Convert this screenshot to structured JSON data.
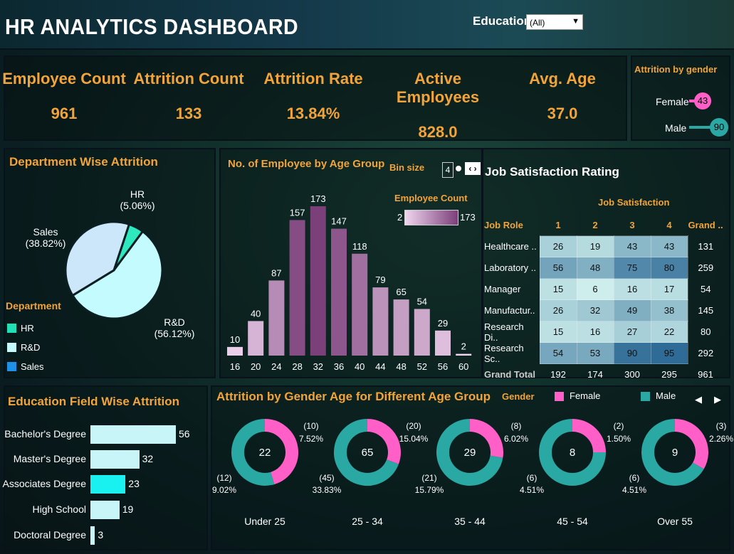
{
  "header": {
    "title": "HR ANALYTICS DASHBOARD",
    "education_label": "Education",
    "education_value": "(All)"
  },
  "kpis": [
    {
      "label": "Employee Count",
      "value": "961"
    },
    {
      "label": "Attrition Count",
      "value": "133"
    },
    {
      "label": "Attrition Rate",
      "value": "13.84%"
    },
    {
      "label": "Active Employees",
      "value": "828.0"
    },
    {
      "label": "Avg. Age",
      "value": "37.0"
    }
  ],
  "gender_attrition": {
    "title": "Attrition by gender",
    "female_label": "Female",
    "female_value": "43",
    "male_label": "Male",
    "male_value": "90",
    "female_color": "#ff5fc6",
    "male_color": "#2aa8a3"
  },
  "department": {
    "title": "Department Wise Attrition",
    "legend_title": "Department",
    "slices": [
      {
        "name": "HR",
        "pct": "(5.06%)",
        "value": 5.06,
        "color": "#2ee8c0"
      },
      {
        "name": "R&D",
        "pct": "(56.12%)",
        "value": 56.12,
        "color": "#c4fbff"
      },
      {
        "name": "Sales",
        "pct": "(38.82%)",
        "value": 38.82,
        "color": "#cde7fa"
      }
    ],
    "legend": [
      {
        "name": "HR",
        "color": "#21e0b5"
      },
      {
        "name": "R&D",
        "color": "#c4fbff"
      },
      {
        "name": "Sales",
        "color": "#1e90e8"
      }
    ]
  },
  "age_group": {
    "title": "No. of Employee by Age Group",
    "bin_label": "Bin size",
    "bin_value": "4",
    "legend_title": "Employee Count",
    "legend_min": "2",
    "legend_max": "173"
  },
  "chart_data": [
    {
      "type": "bar",
      "title": "No. of Employee by Age Group",
      "categories": [
        "16",
        "20",
        "24",
        "28",
        "32",
        "36",
        "40",
        "44",
        "48",
        "52",
        "56",
        "60"
      ],
      "values": [
        10,
        40,
        87,
        157,
        173,
        147,
        118,
        79,
        65,
        54,
        29,
        2
      ],
      "color_min": "#f0d6ef",
      "color_max": "#7b3f7a"
    },
    {
      "type": "bar",
      "title": "Education Field Wise Attrition",
      "orientation": "horizontal",
      "categories": [
        "Bachelor's Degree",
        "Master's Degree",
        "Associates Degree",
        "High School",
        "Doctoral Degree"
      ],
      "values": [
        56,
        32,
        23,
        19,
        3
      ]
    },
    {
      "type": "pie",
      "title": "Department Wise Attrition",
      "categories": [
        "HR",
        "R&D",
        "Sales"
      ],
      "values": [
        5.06,
        56.12,
        38.82
      ]
    }
  ],
  "job_satisfaction": {
    "title": "Job Satisfaction Rating",
    "sub_header": "Job Satisfaction",
    "columns": [
      "Job Role",
      "1",
      "2",
      "3",
      "4",
      "Grand .."
    ],
    "rows": [
      {
        "role": "Healthcare ..",
        "v": [
          26,
          19,
          43,
          43
        ],
        "total": "131"
      },
      {
        "role": "Laboratory ..",
        "v": [
          56,
          48,
          75,
          80
        ],
        "total": "259"
      },
      {
        "role": "Manager",
        "v": [
          15,
          6,
          16,
          17
        ],
        "total": "54"
      },
      {
        "role": "Manufactur..",
        "v": [
          26,
          32,
          49,
          38
        ],
        "total": "145"
      },
      {
        "role": "Research Di..",
        "v": [
          15,
          16,
          27,
          22
        ],
        "total": "80"
      },
      {
        "role": "Research Sc..",
        "v": [
          54,
          53,
          90,
          95
        ],
        "total": "292"
      }
    ],
    "grand_total": {
      "label": "Grand Total",
      "v": [
        "192",
        "174",
        "300",
        "295"
      ],
      "total": "961"
    }
  },
  "education_field": {
    "title": "Education Field Wise Attrition",
    "items": [
      {
        "label": "Bachelor's Degree",
        "value": "56",
        "color": "#c8f5f8"
      },
      {
        "label": "Master's Degree",
        "value": "32",
        "color": "#c8f5f8"
      },
      {
        "label": "Associates Degree",
        "value": "23",
        "color": "#19f0f0"
      },
      {
        "label": "High School",
        "value": "19",
        "color": "#c8f5f8"
      },
      {
        "label": "Doctoral Degree",
        "value": "3",
        "color": "#c8f5f8"
      }
    ]
  },
  "gender_age": {
    "title": "Attrition by Gender Age for Different Age Group",
    "legend_title": "Gender",
    "female_label": "Female",
    "male_label": "Male",
    "groups": [
      {
        "label": "Under 25",
        "total": "22",
        "f_count": "(10)",
        "f_pct": "7.52%",
        "m_count": "(12)",
        "m_pct": "9.02%",
        "female": 10,
        "male": 12
      },
      {
        "label": "25 - 34",
        "total": "65",
        "f_count": "(20)",
        "f_pct": "15.04%",
        "m_count": "(45)",
        "m_pct": "33.83%",
        "female": 20,
        "male": 45
      },
      {
        "label": "35 - 44",
        "total": "29",
        "f_count": "(8)",
        "f_pct": "6.02%",
        "m_count": "(21)",
        "m_pct": "15.79%",
        "female": 8,
        "male": 21
      },
      {
        "label": "45 - 54",
        "total": "8",
        "f_count": "(2)",
        "f_pct": "1.50%",
        "m_count": "(6)",
        "m_pct": "4.51%",
        "female": 2,
        "male": 6
      },
      {
        "label": "Over 55",
        "total": "9",
        "f_count": "(3)",
        "f_pct": "2.26%",
        "m_count": "(6)",
        "m_pct": "4.51%",
        "female": 3,
        "male": 6
      }
    ]
  }
}
